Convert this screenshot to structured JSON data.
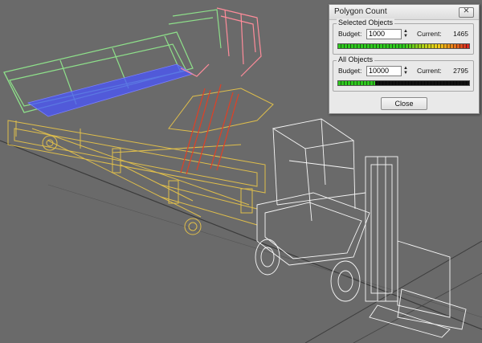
{
  "dialog": {
    "title": "Polygon Count",
    "close_glyph": "⨯",
    "selected_objects": {
      "legend": "Selected Objects",
      "budget_label": "Budget:",
      "budget_value": "1000",
      "current_label": "Current:",
      "current_value": "1465",
      "meter_fraction": 1.0
    },
    "all_objects": {
      "legend": "All Objects",
      "budget_label": "Budget:",
      "budget_value": "10000",
      "current_label": "Current:",
      "current_value": "2795",
      "meter_fraction": 0.28
    },
    "close_button_label": "Close"
  },
  "colors": {
    "viewport_bg": "#6a6a6a",
    "trailer_wire": "#e6c34a",
    "bed_wire": "#8ee08a",
    "bed_floor": "#4a55ff",
    "rail_wire": "#ff8c9a",
    "lift_wire": "#d8432a",
    "forklift_wire": "#ffffff",
    "meter_green": "#2ec81e",
    "meter_red": "#d62020"
  },
  "icons": {
    "dialog_close": "close-icon",
    "spinner_up": "spinner-up-icon",
    "spinner_down": "spinner-down-icon"
  }
}
